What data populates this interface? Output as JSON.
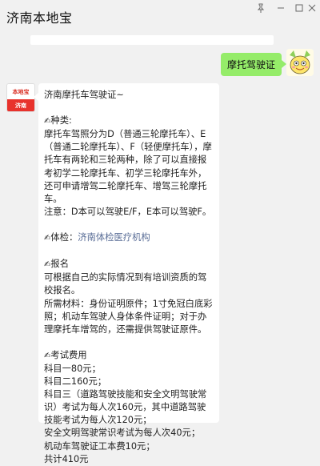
{
  "window": {
    "title": "济南本地宝",
    "pin_icon": "pin-icon",
    "minimize_icon": "minimize-icon",
    "maximize_icon": "maximize-icon",
    "close_icon": "close-icon"
  },
  "chat": {
    "sent_message": "摩托驾驶证",
    "left_avatar_top": "本地宝",
    "left_avatar_bottom": "济南",
    "reply": {
      "intro": "济南摩托车驾驶证~",
      "kind_heading": "种类:",
      "kind_text": "摩托车驾照分为D（普通三轮摩托车）、E（普通二轮摩托车）、F（轻便摩托车），摩托车有两轮和三轮两种，除了可以直接报考初学二轮摩托车、初学三轮摩托车外，还可申请增驾二轮摩托车、增驾三轮摩托车。",
      "kind_note": "注意：D本可以驾驶E/F，E本可以驾驶F。",
      "exam_label": "体检：",
      "exam_link": "济南体检医疗机构",
      "signup_heading": "报名",
      "signup_text": "可根据自己的实际情况到有培训资质的驾校报名。",
      "materials_text": "所需材料：身份证明原件；1寸免冠白底彩照；机动车驾驶人身体条件证明；对于办理摩托车增驾的，还需提供驾驶证原件。",
      "fee_heading": "考试费用",
      "fee_1": "科目一80元；",
      "fee_2": "科目二160元；",
      "fee_3": "科目三（道路驾驶技能和安全文明驾驶常识）考试为每人次160元，其中道路驾驶技能考试为每人次120元；",
      "fee_4": "安全文明驾驶常识考试为每人次40元；",
      "fee_5": "机动车驾驶证工本费10元；",
      "fee_total": "共计410元",
      "hand_icon": "writing-hand-icon"
    }
  }
}
